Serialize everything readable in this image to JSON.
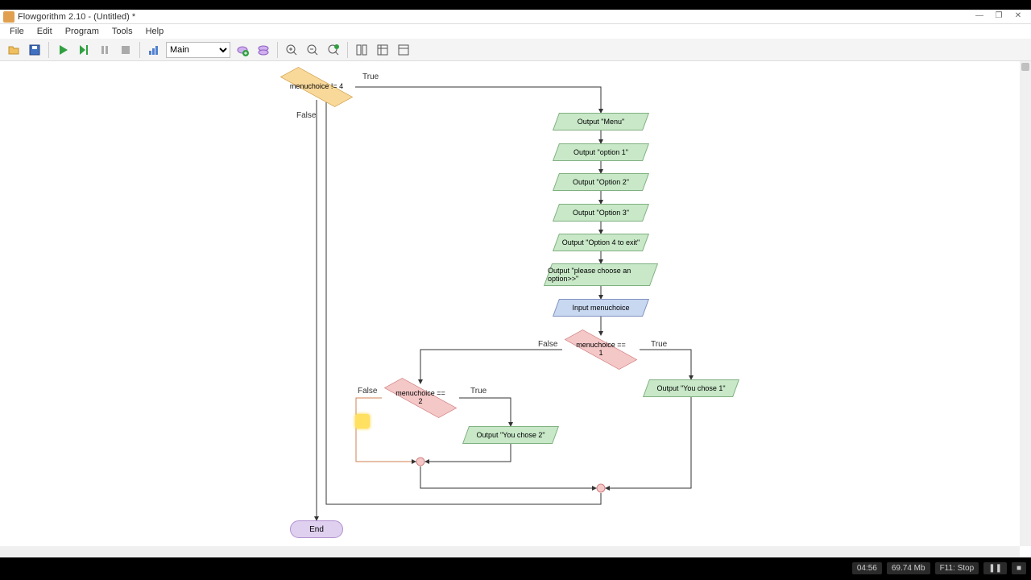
{
  "window": {
    "title": "Flowgorithm 2.10 - (Untitled) *",
    "min": "—",
    "max": "❐",
    "close": "✕"
  },
  "menu": {
    "file": "File",
    "edit": "Edit",
    "program": "Program",
    "tools": "Tools",
    "help": "Help"
  },
  "toolbar": {
    "function_selected": "Main"
  },
  "diagram": {
    "loop_cond": "menuchoice != 4",
    "loop_true": "True",
    "loop_false": "False",
    "out_menu": "Output \"Menu\"",
    "out_opt1": "Output \"option 1\"",
    "out_opt2": "Output \"Option 2\"",
    "out_opt3": "Output \"Option 3\"",
    "out_opt4": "Output \"Option 4 to exit\"",
    "out_prompt": "Output \"please choose an option>>\"",
    "in_choice": "Input menuchoice",
    "dec1": "menuchoice == 1",
    "dec1_true": "True",
    "dec1_false": "False",
    "out_chose1": "Output \"You chose 1\"",
    "dec2": "menuchoice == 2",
    "dec2_true": "True",
    "dec2_false": "False",
    "out_chose2": "Output \"You chose 2\"",
    "end": "End"
  },
  "status": {
    "time": "04:56",
    "mem": "69.74 Mb",
    "rec": "F11: Stop"
  }
}
